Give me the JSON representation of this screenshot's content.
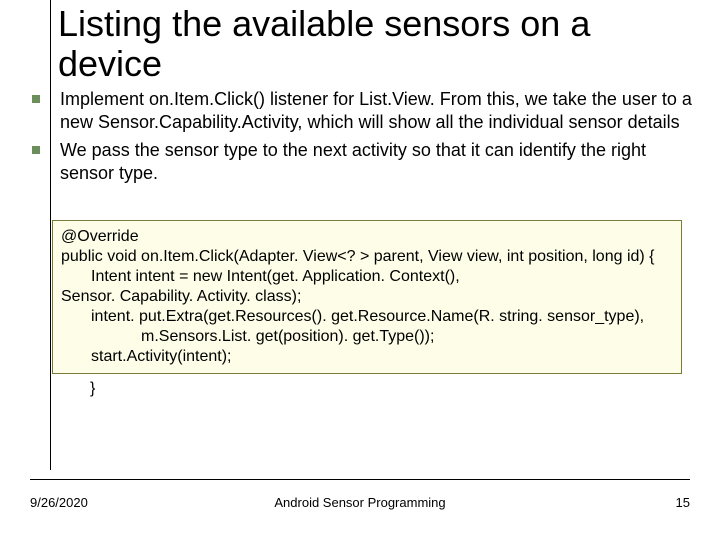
{
  "title": "Listing the available sensors on a device",
  "bullets": {
    "b1": "Implement on.Item.Click() listener for List.View. From this, we take the user to a new Sensor.Capability.Activity, which will show all the individual sensor details",
    "b2": "We pass the sensor type to the next activity so that it can identify the right sensor type."
  },
  "code": {
    "l1": "@Override",
    "l2": "public void on.Item.Click(Adapter. View<? > parent, View view, int position, long id) {",
    "l3": "Intent intent = new Intent(get. Application. Context(),",
    "l4": "Sensor. Capability. Activity. class);",
    "l5": "intent. put.Extra(get.Resources(). get.Resource.Name(R. string. sensor_type),",
    "l6": "m.Sensors.List. get(position). get.Type());",
    "l7": "start.Activity(intent);",
    "l8": "}"
  },
  "footer": {
    "date": "9/26/2020",
    "center": "Android Sensor Programming",
    "page": "15"
  }
}
